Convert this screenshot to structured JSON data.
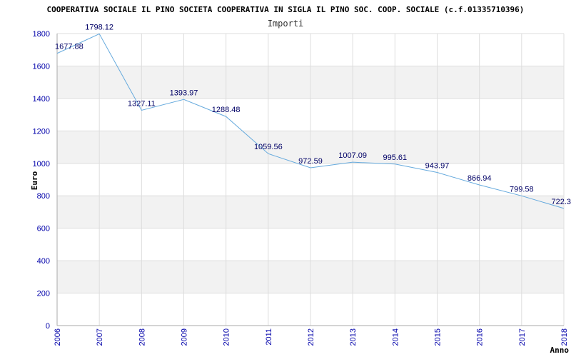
{
  "chart_data": {
    "type": "line",
    "title": "COOPERATIVA SOCIALE IL PINO SOCIETA COOPERATIVA IN SIGLA IL PINO SOC. COOP. SOCIALE (c.f.01335710396)",
    "subtitle": "Importi",
    "xlabel": "Anno",
    "ylabel": "Euro",
    "ylim": [
      0,
      1800
    ],
    "yticks": [
      0,
      200,
      400,
      600,
      800,
      1000,
      1200,
      1400,
      1600,
      1800
    ],
    "grid": true,
    "x": [
      "2006",
      "2007",
      "2008",
      "2009",
      "2010",
      "2011",
      "2012",
      "2013",
      "2014",
      "2015",
      "2016",
      "2017",
      "2018"
    ],
    "series": [
      {
        "values": [
          1677.88,
          1798.12,
          1327.11,
          1393.97,
          1288.48,
          1059.56,
          972.59,
          1007.09,
          995.61,
          943.97,
          866.94,
          799.58,
          722.3
        ],
        "labels": [
          "1677.88",
          "1798.12",
          "1327.11",
          "1393.97",
          "1288.48",
          "1059.56",
          "972.59",
          "1007.09",
          "995.61",
          "943.97",
          "866.94",
          "799.58",
          "722.3"
        ],
        "color": "#66aadd"
      }
    ],
    "colors": {
      "band": "#f2f2f2",
      "grid": "#dddddd",
      "axis": "#aaaaaa",
      "tick_text": "#0000aa",
      "label_text": "#000066"
    }
  }
}
